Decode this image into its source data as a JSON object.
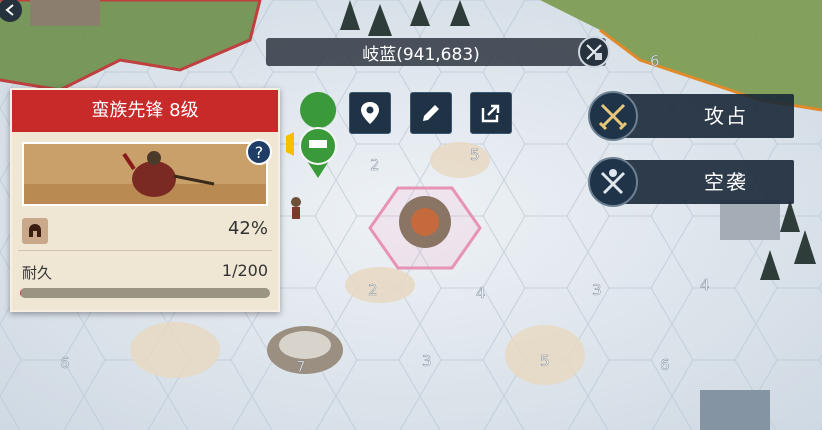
{
  "location": {
    "name": "岐蓝(941,683)"
  },
  "actions": {
    "attack_label": "攻占",
    "airstrike_label": "空袭"
  },
  "target": {
    "title": "蛮族先锋 8级",
    "morale_value": "42%",
    "durability_label": "耐久",
    "durability_value": "1/200",
    "durability_fraction": 0.005
  },
  "map": {
    "tile_levels": [
      "2",
      "3",
      "4",
      "5",
      "6",
      "7",
      "2",
      "3",
      "4",
      "5",
      "6",
      "6"
    ]
  },
  "colors": {
    "header_red": "#c82a2a",
    "panel_cream": "#efe6d4",
    "button_navy": "#203246",
    "snow": "#dfe6ee"
  },
  "icons": [
    "location-pin-icon",
    "edit-pencil-icon",
    "share-icon",
    "crossed-swords-icon",
    "airstrike-icon",
    "help-icon",
    "helmet-icon",
    "alliance-badge-icon",
    "back-arrow-icon",
    "green-map-marker-icon"
  ]
}
